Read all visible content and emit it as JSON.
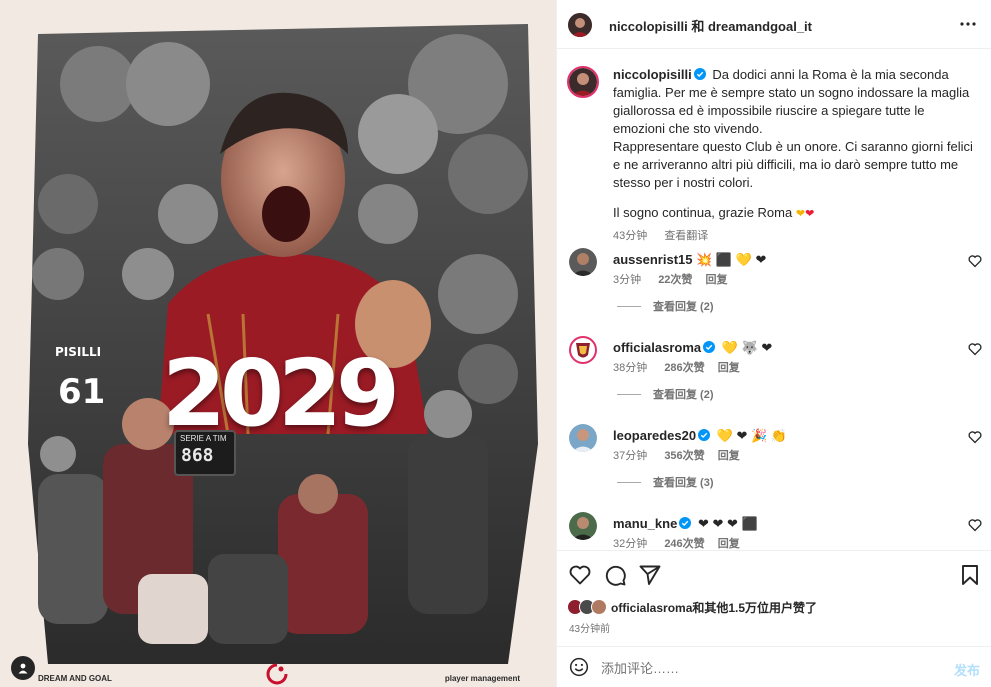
{
  "header": {
    "users": "niccolopisilli 和 dreamandgoal_it"
  },
  "poster": {
    "year": "2029",
    "shirt_name": "PISILLI",
    "shirt_number": "61",
    "scoreboard_label": "SERIE A TIM",
    "scoreboard_number": "868",
    "brand_left": "DREAM AND GOAL",
    "brand_right": "player management"
  },
  "caption": {
    "username": "niccolopisilli",
    "para1": "Da dodici anni la Roma è la mia seconda famiglia. Per me è sempre stato un sogno indossare la maglia giallorossa ed è impossibile riuscire a spiegare tutte le emozioni che sto vivendo.",
    "para2": "Rappresentare questo Club è un onore. Ci saranno giorni felici e ne arriveranno altri più difficili, ma io darò sempre tutto me stesso per i nostri colori.",
    "para3": "Il sogno continua, grazie Roma",
    "time": "43分钟",
    "translate": "查看翻译"
  },
  "comments": [
    {
      "username": "aussenrist15",
      "verified": false,
      "text": "💥 ⬛ 💛 ❤",
      "time": "3分钟",
      "likes": "22次赞",
      "reply": "回复",
      "view_replies": "查看回复 (2)"
    },
    {
      "username": "officialasroma",
      "verified": true,
      "text": "💛 🐺 ❤",
      "time": "38分钟",
      "likes": "286次赞",
      "reply": "回复",
      "view_replies": "查看回复 (2)"
    },
    {
      "username": "leoparedes20",
      "verified": true,
      "text": "💛 ❤ 🎉 👏",
      "time": "37分钟",
      "likes": "356次赞",
      "reply": "回复",
      "view_replies": "查看回复 (3)"
    },
    {
      "username": "manu_kne",
      "verified": true,
      "text": "❤ ❤ ❤ ⬛",
      "time": "32分钟",
      "likes": "246次赞",
      "reply": "回复",
      "view_replies": ""
    }
  ],
  "likes": {
    "text": "officialasroma和其他1.5万位用户赞了",
    "time": "43分钟前"
  },
  "composer": {
    "placeholder": "添加评论……",
    "post_label": "发布"
  },
  "colors": {
    "verified_blue": "#0095f6",
    "heart_red": "#ed1c3a",
    "roma_red": "#9b1b25"
  },
  "icons": [
    "more-icon",
    "verified-icon",
    "heart-icon",
    "comment-icon",
    "share-icon",
    "bookmark-icon",
    "emoji-icon",
    "user-icon"
  ]
}
